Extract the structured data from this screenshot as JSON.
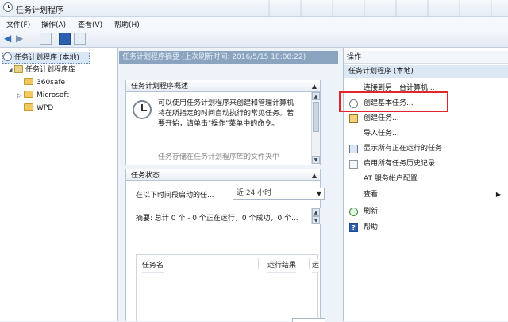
{
  "window": {
    "title": "任务计划程序"
  },
  "menu": [
    "文件(F)",
    "操作(A)",
    "查看(V)",
    "帮助(H)"
  ],
  "tree": {
    "root": "任务计划程序 (本地)",
    "library": "任务计划程序库",
    "folders": [
      "360safe",
      "Microsoft",
      "WPD"
    ]
  },
  "mid": {
    "header": "任务计划程序摘要 (上次刷新时间: 2016/5/15 18:08:22)",
    "overview": {
      "title": "任务计划程序概述",
      "text": "可以使用任务计划程序来创建和管理计算机将在所指定的时间自动执行的常见任务。若要开始，请单击\"操作\"菜单中的命令。",
      "text2": "任务存储在任务计划程序库的文件夹中"
    },
    "status": {
      "title": "任务状态",
      "period_label": "在以下时间段启动的任...",
      "period_value": "近 24 小时",
      "summary": "摘要: 总计 0 个 - 0 个正在运行，0 个成功，0 个...",
      "columns": [
        "任务名",
        "运行结果",
        "运"
      ]
    }
  },
  "actions": {
    "header": "操作",
    "group": "任务计划程序 (本地)",
    "items": [
      {
        "label": "连接到另一台计算机...",
        "icon": "none"
      },
      {
        "label": "创建基本任务...",
        "icon": "clock-icon"
      },
      {
        "label": "创建任务...",
        "icon": "task-icon"
      },
      {
        "label": "导入任务...",
        "icon": "none"
      },
      {
        "label": "显示所有正在运行的任务",
        "icon": "list-icon"
      },
      {
        "label": "启用所有任务历史记录",
        "icon": "doc-icon"
      },
      {
        "label": "AT 服务帐户配置",
        "icon": "none"
      },
      {
        "label": "查看",
        "icon": "none"
      },
      {
        "label": "刷新",
        "icon": "refresh-icon"
      },
      {
        "label": "帮助",
        "icon": "help-icon"
      }
    ],
    "highlight_color": "#e0262b"
  }
}
